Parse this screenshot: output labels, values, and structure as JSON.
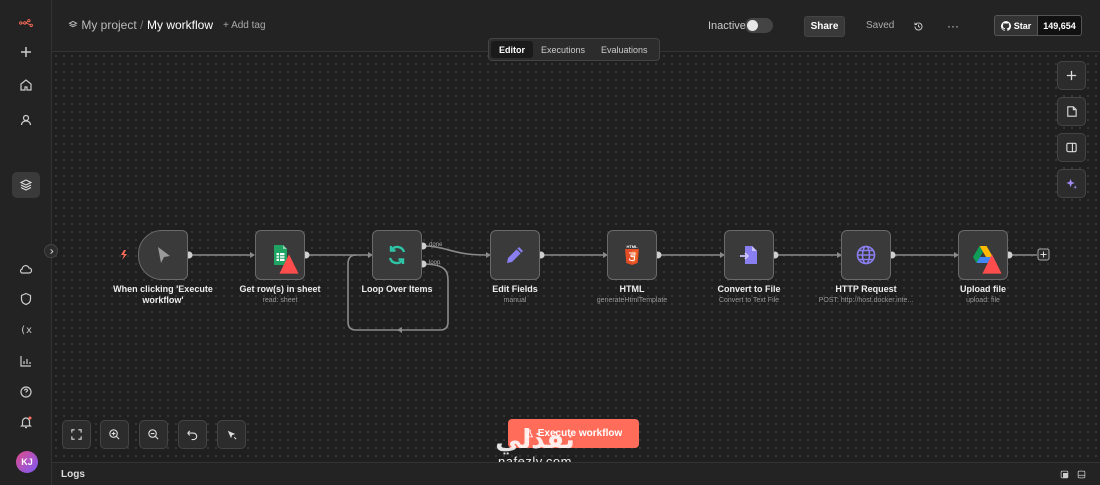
{
  "header": {
    "project": "My project",
    "workflow": "My workflow",
    "add_tag": "+ Add tag",
    "status": "Inactive",
    "share": "Share",
    "saved": "Saved",
    "star": "Star",
    "star_count": "149,654"
  },
  "tabs": [
    {
      "label": "Editor",
      "active": true
    },
    {
      "label": "Executions",
      "active": false
    },
    {
      "label": "Evaluations",
      "active": false
    }
  ],
  "nodes": [
    {
      "title": "When clicking 'Execute workflow'",
      "subtitle": "",
      "icon": "pointer-icon"
    },
    {
      "title": "Get row(s) in sheet",
      "subtitle": "read: sheet",
      "icon": "google-sheets-icon"
    },
    {
      "title": "Loop Over Items",
      "subtitle": "",
      "icon": "loop-icon"
    },
    {
      "title": "Edit Fields",
      "subtitle": "manual",
      "icon": "pencil-icon"
    },
    {
      "title": "HTML",
      "subtitle": "generateHtmlTemplate",
      "icon": "html5-icon"
    },
    {
      "title": "Convert to File",
      "subtitle": "Convert to Text File",
      "icon": "file-convert-icon"
    },
    {
      "title": "HTTP Request",
      "subtitle": "POST: http://host.docker.inte...",
      "icon": "globe-icon"
    },
    {
      "title": "Upload file",
      "subtitle": "upload: file",
      "icon": "google-drive-icon"
    }
  ],
  "loop_ports": {
    "done": "done",
    "loop": "loop"
  },
  "execute_button": "Execute workflow",
  "logs": "Logs",
  "user_initials": "KJ",
  "watermark": {
    "brand": "نفذلي",
    "site": "nafezly.com"
  },
  "colors": {
    "accent": "#ff6d5a",
    "canvas": "#1f1f1f",
    "node": "#3a3a3a"
  }
}
